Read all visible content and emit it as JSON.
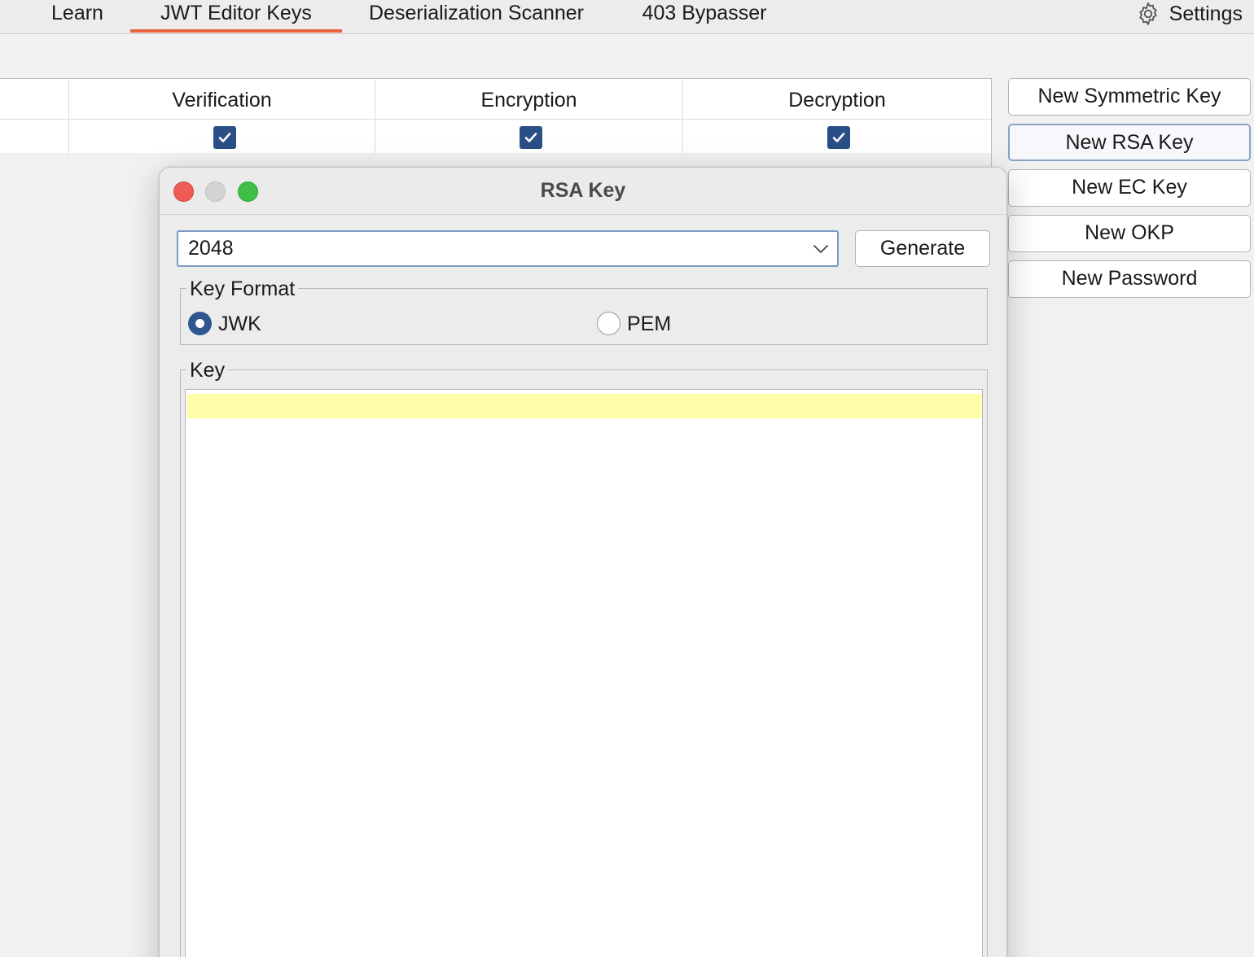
{
  "tabs": [
    {
      "label": "Learn",
      "active": false
    },
    {
      "label": "JWT Editor Keys",
      "active": true
    },
    {
      "label": "Deserialization Scanner",
      "active": false
    },
    {
      "label": "403 Bypasser",
      "active": false
    }
  ],
  "settings": {
    "label": "Settings",
    "icon": "gear-icon"
  },
  "keys_table": {
    "columns": [
      "Verification",
      "Encryption",
      "Decryption"
    ],
    "rows": [
      {
        "verification": true,
        "encryption": true,
        "decryption": true
      }
    ]
  },
  "actions": [
    {
      "label": "New Symmetric Key"
    },
    {
      "label": "New RSA Key",
      "focused": true
    },
    {
      "label": "New EC Key"
    },
    {
      "label": "New OKP"
    },
    {
      "label": "New Password"
    }
  ],
  "dialog": {
    "title": "RSA Key",
    "key_size": {
      "value": "2048"
    },
    "generate_label": "Generate",
    "key_format": {
      "legend": "Key Format",
      "options": [
        {
          "label": "JWK",
          "selected": true
        },
        {
          "label": "PEM",
          "selected": false
        }
      ]
    },
    "key": {
      "legend": "Key",
      "value": ""
    }
  },
  "colors": {
    "accent_tab_underline": "#e8643c",
    "checkbox": "#2a4f86",
    "radio_selected": "#2f568f",
    "current_line_highlight": "#ffffaa",
    "close_button": "#ee5c54",
    "maximize_button": "#3fbf46"
  }
}
